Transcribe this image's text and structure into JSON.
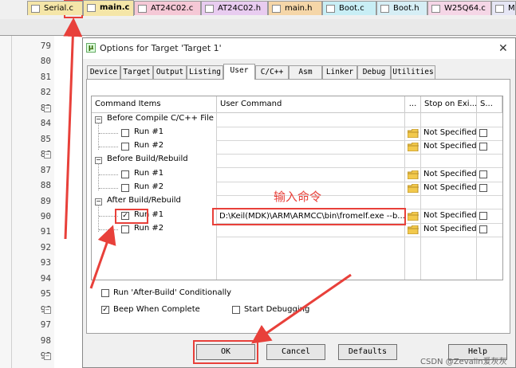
{
  "colors": {
    "annotation": "#e8403a",
    "panel_bg": "#ffffff",
    "dialog_bg": "#f0f0f0"
  },
  "toolbar": {
    "icons": [
      "dropdown-icon",
      "magic-wand-icon",
      "pack-icon",
      "layers-icon",
      "green-diamond-icon",
      "bug-icon",
      "settings-icon"
    ]
  },
  "file_tabs": [
    {
      "label": "Serial.c",
      "color": "#f5e6a8",
      "active": false
    },
    {
      "label": "main.c",
      "color": "#f5e6a8",
      "active": true
    },
    {
      "label": "AT24C02.c",
      "color": "#f5c8d6",
      "active": false
    },
    {
      "label": "AT24C02.h",
      "color": "#e8ccf0",
      "active": false
    },
    {
      "label": "main.h",
      "color": "#f5d6a8",
      "active": false
    },
    {
      "label": "Boot.c",
      "color": "#c8eef5",
      "active": false
    },
    {
      "label": "Boot.h",
      "color": "#d6eef5",
      "active": false
    },
    {
      "label": "W25Q64.c",
      "color": "#f5d6e6",
      "active": false
    },
    {
      "label": "My",
      "color": "#e6e6f5",
      "active": false
    }
  ],
  "editor": {
    "line_numbers": [
      "79",
      "80",
      "81",
      "82",
      "83",
      "84",
      "85",
      "86",
      "87",
      "88",
      "89",
      "90",
      "91",
      "92",
      "93",
      "94",
      "95",
      "96",
      "97",
      "98",
      "99"
    ],
    "fold_lines": [
      "83",
      "86",
      "96",
      "99"
    ]
  },
  "dialog": {
    "title": "Options for Target 'Target 1'",
    "close_glyph": "✕",
    "tabs": [
      "Device",
      "Target",
      "Output",
      "Listing",
      "User",
      "C/C++",
      "Asm",
      "Linker",
      "Debug",
      "Utilities"
    ],
    "active_tab": "User",
    "grid_headers": {
      "items": "Command Items",
      "command": "User Command",
      "browse": "...",
      "stop": "Stop on Exi...",
      "s": "S..."
    },
    "groups": [
      {
        "label": "Before Compile C/C++ File",
        "toggle": "−",
        "runs": [
          {
            "label": "Run #1",
            "checked": false,
            "command": "",
            "stop": "Not Specified"
          },
          {
            "label": "Run #2",
            "checked": false,
            "command": "",
            "stop": "Not Specified"
          }
        ]
      },
      {
        "label": "Before Build/Rebuild",
        "toggle": "−",
        "runs": [
          {
            "label": "Run #1",
            "checked": false,
            "command": "",
            "stop": "Not Specified"
          },
          {
            "label": "Run #2",
            "checked": false,
            "command": "",
            "stop": "Not Specified"
          }
        ]
      },
      {
        "label": "After Build/Rebuild",
        "toggle": "−",
        "runs": [
          {
            "label": "Run #1",
            "checked": true,
            "command": "D:\\Keil(MDK)\\ARM\\ARMCC\\bin\\fromelf.exe --b...",
            "stop": "Not Specified"
          },
          {
            "label": "Run #2",
            "checked": false,
            "command": "",
            "stop": "Not Specified"
          }
        ]
      }
    ],
    "annotation": "输入命令",
    "options": {
      "run_after_build": {
        "label": "Run 'After-Build' Conditionally",
        "checked": false
      },
      "beep": {
        "label": "Beep When Complete",
        "checked": true
      },
      "start_debugging": {
        "label": "Start Debugging",
        "checked": false
      }
    },
    "buttons": {
      "ok": "OK",
      "cancel": "Cancel",
      "defaults": "Defaults",
      "help": "Help"
    }
  },
  "watermark": "CSDN @Zevalin爱灰灰"
}
